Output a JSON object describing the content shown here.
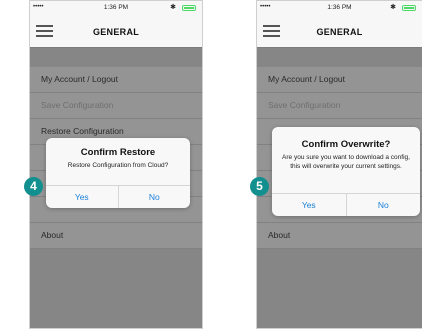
{
  "screens": [
    {
      "status": {
        "signal": "•••••",
        "time": "1:36 PM",
        "bluetooth": "✱"
      },
      "nav": {
        "title": "GENERAL"
      },
      "menu": [
        {
          "label": "My Account / Logout",
          "disabled": false
        },
        {
          "label": "Save Configuration",
          "disabled": true
        },
        {
          "label": "Restore Configuration",
          "disabled": false
        },
        {
          "label": "",
          "disabled": false
        },
        {
          "label": "",
          "disabled": false
        },
        {
          "label": "",
          "disabled": false
        },
        {
          "label": "About",
          "disabled": false
        }
      ],
      "dialog": {
        "title": "Confirm Restore",
        "message": "Restore Configuration from Cloud?",
        "yes": "Yes",
        "no": "No"
      },
      "step": "4"
    },
    {
      "status": {
        "signal": "•••••",
        "time": "1:36 PM",
        "bluetooth": "✱"
      },
      "nav": {
        "title": "GENERAL"
      },
      "menu": [
        {
          "label": "My Account / Logout",
          "disabled": false
        },
        {
          "label": "Save Configuration",
          "disabled": true
        },
        {
          "label": "",
          "disabled": false
        },
        {
          "label": "",
          "disabled": false
        },
        {
          "label": "",
          "disabled": false
        },
        {
          "label": "",
          "disabled": false
        },
        {
          "label": "About",
          "disabled": false
        }
      ],
      "dialog": {
        "title": "Confirm Overwrite?",
        "message": "Are you sure you want to download a config, this will overwrite your current settings.",
        "yes": "Yes",
        "no": "No"
      },
      "step": "5"
    }
  ],
  "colors": {
    "accent": "#1a7fd8",
    "step_badge": "#128f8f",
    "battery": "#4cd964"
  }
}
